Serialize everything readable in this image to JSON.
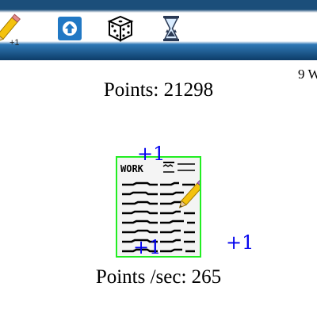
{
  "toolbar": {
    "tools": [
      {
        "name": "pencil-tool",
        "icon": "pencil-icon",
        "caption": "+1"
      },
      {
        "name": "upgrade-button",
        "icon": "up-arrow-icon",
        "color": "#2178c4"
      },
      {
        "name": "dice-button",
        "icon": "dice-icon"
      },
      {
        "name": "hourglass-button",
        "icon": "hourglass-icon"
      }
    ]
  },
  "corner_text": "9 W",
  "score": {
    "points": "Points: 21298",
    "points_per_sec": "Points /sec: 265"
  },
  "work_card": {
    "title": "WORK",
    "border_color": "#22ee22"
  },
  "floating_gains": [
    "+1",
    "+1",
    "+1"
  ],
  "colors": {
    "bar_dark": "#1b4e7a",
    "bar_light": "#2f78b6",
    "float_text": "#0000ee"
  }
}
